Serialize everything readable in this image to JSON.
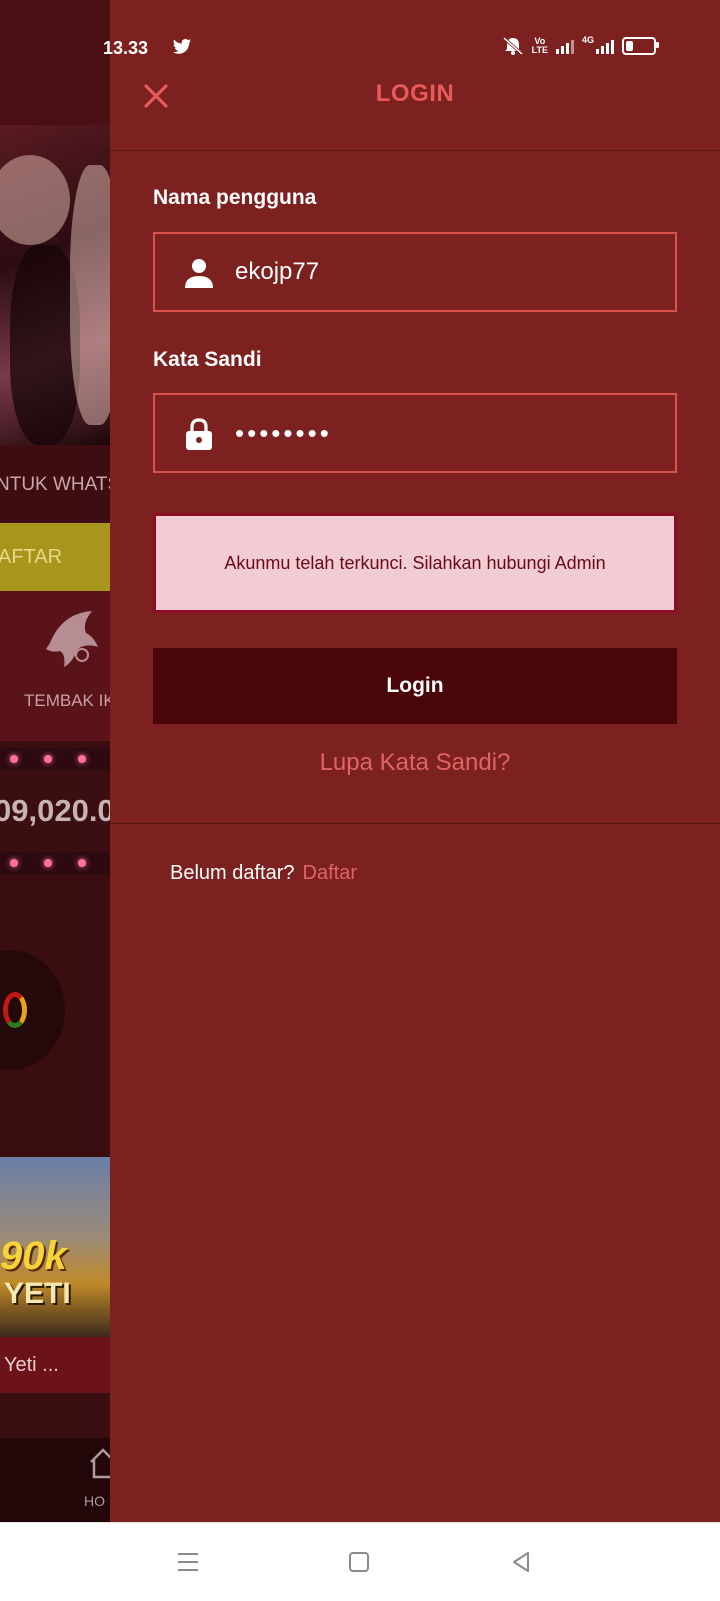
{
  "status_bar": {
    "time": "13.33",
    "network_label": "4G",
    "volte_label": "Vo\nLTE",
    "battery_percent": 30
  },
  "background_app": {
    "marquee_text": "NTUK WHATSA",
    "register_button_partial": "AFTAR",
    "category_label_partial": "TEMBAK IKAN",
    "jackpot_partial": "09,020.0",
    "game_art_text_1": "90k",
    "game_art_text_2": "YETI",
    "game_title_partial": "Yeti ...",
    "nav_home_label": "HO"
  },
  "login_drawer": {
    "title": "LOGIN",
    "username_label": "Nama pengguna",
    "username_value": "ekojp77",
    "password_label": "Kata Sandi",
    "password_value": "••••••••",
    "error_message": "Akunmu telah terkunci. Silahkan hubungi Admin",
    "login_button": "Login",
    "forgot_password_link": "Lupa Kata Sandi?",
    "register_prompt": "Belum daftar?",
    "register_link": "Daftar"
  },
  "colors": {
    "drawer_bg": "#7c2020",
    "accent_red": "#e06464",
    "login_button_bg": "#4a0508",
    "error_bg": "#f2ccd3",
    "error_border": "#8b0e22"
  },
  "icons": [
    "twitter-icon",
    "mute-bell-icon",
    "signal-icon",
    "battery-icon",
    "close-icon",
    "user-icon",
    "lock-icon",
    "menu-icon",
    "home-square-icon",
    "back-triangle-icon",
    "home-icon"
  ]
}
